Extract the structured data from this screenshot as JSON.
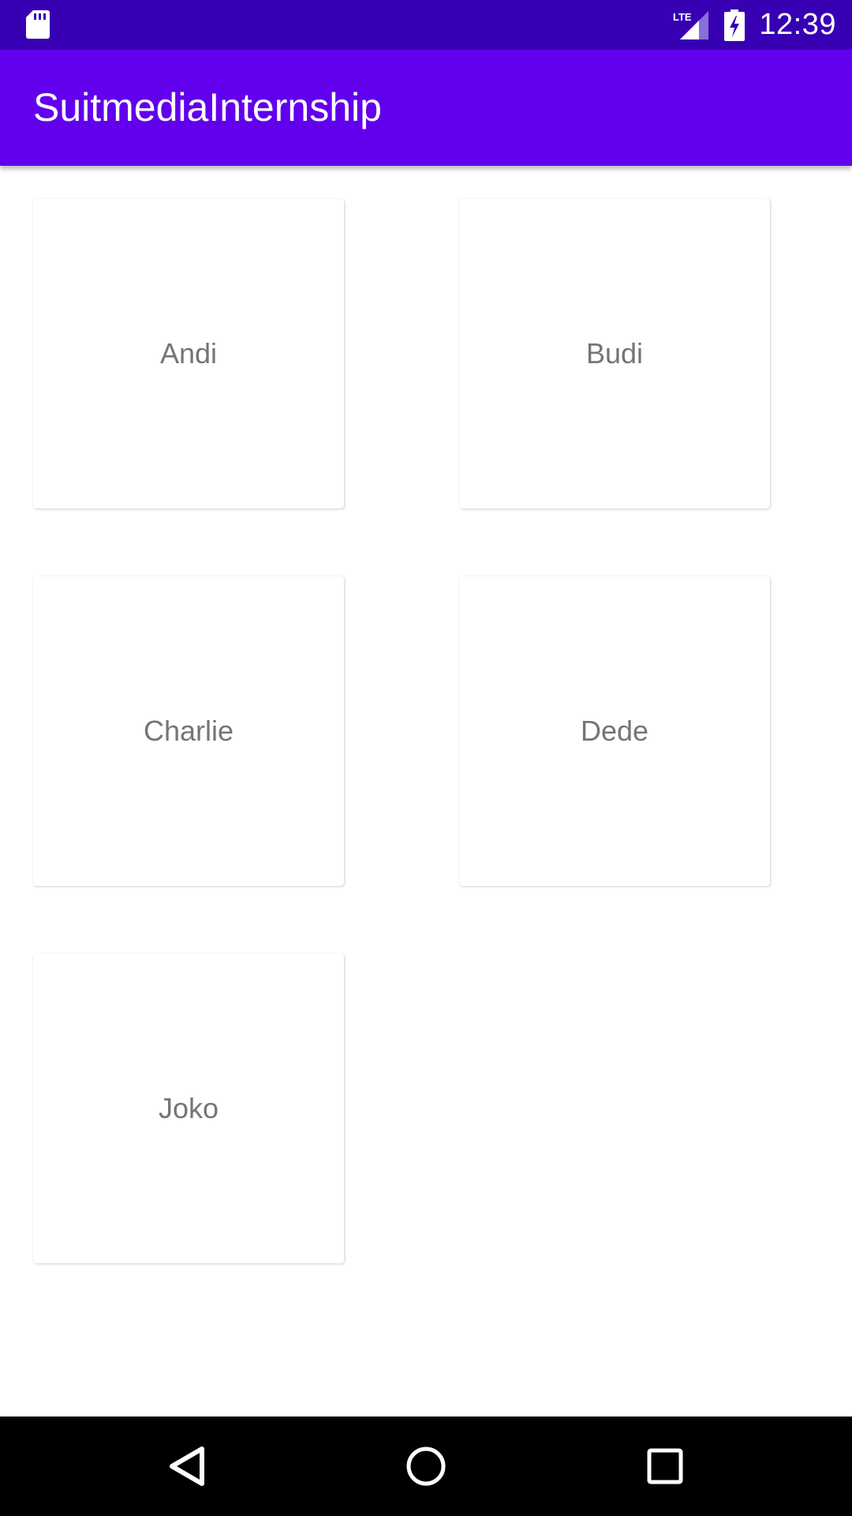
{
  "status_bar": {
    "time": "12:39",
    "network_label": "LTE",
    "icons": [
      "sd-card-icon",
      "lte-signal-icon",
      "battery-charging-icon"
    ],
    "background": "#3700B3"
  },
  "app_bar": {
    "title": "SuitmediaInternship",
    "background": "#6200EE"
  },
  "cards": [
    {
      "label": "Andi"
    },
    {
      "label": "Budi"
    },
    {
      "label": "Charlie"
    },
    {
      "label": "Dede"
    },
    {
      "label": "Joko"
    }
  ],
  "nav_bar": {
    "buttons": [
      "back-icon",
      "home-icon",
      "recents-icon"
    ]
  }
}
